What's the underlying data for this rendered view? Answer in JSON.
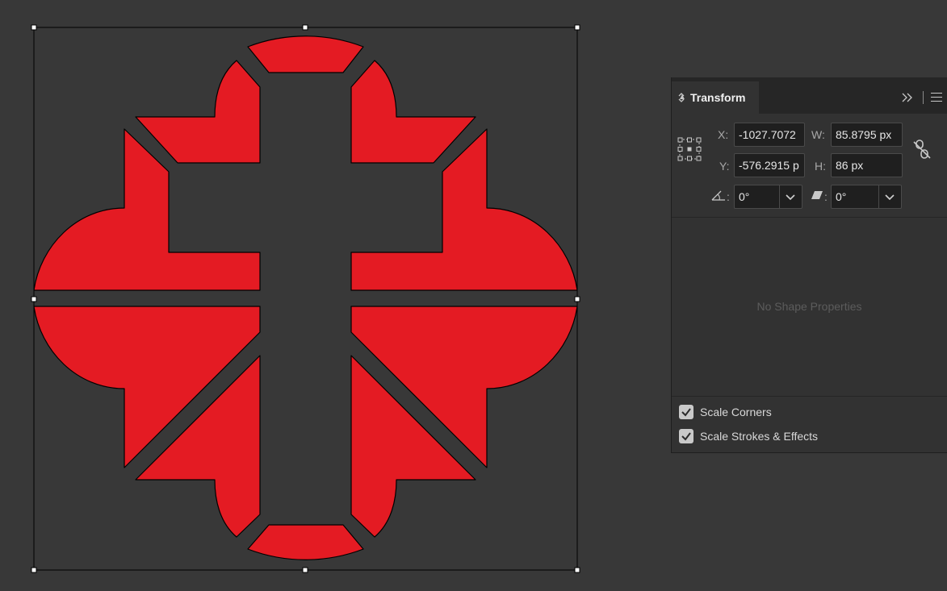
{
  "colors": {
    "canvas_bg": "#383838",
    "shape_fill": "#e41b23",
    "shape_stroke": "#000000",
    "panel_bg": "#323232"
  },
  "canvas": {
    "shape_name": "red-quatrefoil-cross-shape",
    "selection": "bounding-box-with-8-handles"
  },
  "transform_panel": {
    "tab_title": "Transform",
    "reference_point_icon": "reference-point-grid-icon",
    "x_label": "X:",
    "x_value": "-1027.7072",
    "y_label": "Y:",
    "y_value": "-576.2915 p",
    "w_label": "W:",
    "w_value": "85.8795 px",
    "h_label": "H:",
    "h_value": "86 px",
    "constrain_icon": "unlinked-chain-icon",
    "rotate_label": ":",
    "rotate_icon": "rotate-angle-icon",
    "rotate_value": "0°",
    "shear_label": ":",
    "shear_icon": "shear-icon",
    "shear_value": "0°",
    "empty_message": "No Shape Properties",
    "scale_corners": {
      "label": "Scale Corners",
      "checked": true
    },
    "scale_strokes": {
      "label": "Scale Strokes & Effects",
      "checked": true
    }
  }
}
